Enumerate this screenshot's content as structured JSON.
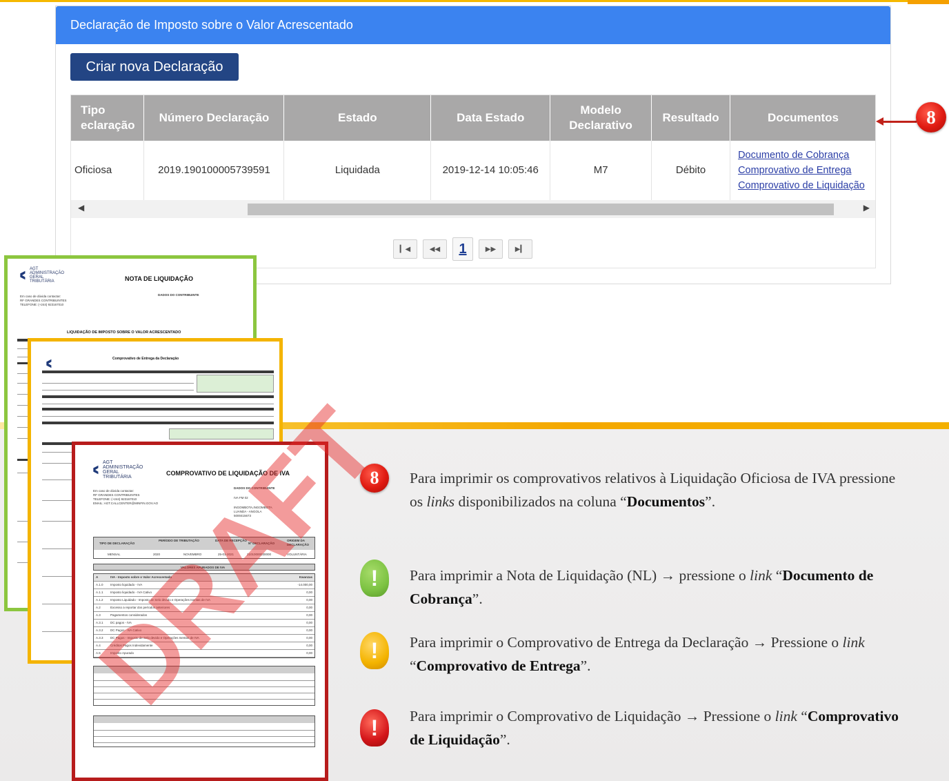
{
  "panel": {
    "title": "Declaração de Imposto sobre o Valor Acrescentado",
    "new_button": "Criar nova Declaração"
  },
  "table": {
    "columns": [
      "Tipo\nDeclaração",
      "Número Declaração",
      "Estado",
      "Data Estado",
      "Modelo\nDeclarativo",
      "Resultado",
      "Documentos"
    ],
    "col_first_visible": "Tipo",
    "col_first_visible2": "eclaração",
    "col_modelo_1": "Modelo",
    "col_modelo_2": "Declarativo",
    "row": {
      "tipo": "Oficiosa",
      "numero": "2019.190100005739591",
      "estado": "Liquidada",
      "data": "2019-12-14 10:05:46",
      "modelo": "M7",
      "resultado": "Débito",
      "docs": [
        "Documento de Cobrança",
        "Comprovativo de Entrega",
        "Comprovativo de Liquidação"
      ]
    }
  },
  "pager": {
    "first": "⏮",
    "prev": "⏪",
    "current": "1",
    "next": "⏩",
    "last": "⏭"
  },
  "callout_badge": "8",
  "docs": {
    "green_title": "NOTA DE LIQUIDAÇÃO",
    "green_subtitle": "LIQUIDAÇÃO DE IMPOSTO SOBRE O VALOR ACRESCENTADO",
    "yellow_title": "Comprovativo de Entrega da Declaração",
    "red_title": "COMPROVATIVO DE LIQUIDAÇÃO DE IVA",
    "red_section": "VALORES APURADOS DE IVA",
    "logo_lines": [
      "AGT",
      "ADMINISTRAÇÃO",
      "GERAL",
      "TRIBUTÁRIA"
    ],
    "contacts": [
      "Em caso de dúvida contactar:",
      "RF GRANDES CONTRIBUINTES",
      "TELEFONE: (+244) 923167010",
      "EMAIL: AGT.CALLCENTER@MINFIN.GOV.AO"
    ],
    "dados": "DADOS DO CONTRIBUINTE",
    "dados_lines": [
      "IVA FM 02",
      "INGOMBOTA,INGOMBOTA",
      "LUANDA - ANGOLA",
      "5000415673"
    ],
    "head_row": [
      "TIPO DE DECLARAÇÃO",
      "PERÍODO DE TRIBUTAÇÃO",
      "DATA DE RECEPÇÃO",
      "Nº DECLARAÇÃO",
      "ORIGEM DA DECLARAÇÃO"
    ],
    "data_row": [
      "MENSAL",
      "2020",
      "NOVEMBRO",
      "25-01-2021",
      "21010000030000",
      "VOLUNTÁRIA"
    ],
    "a_rows": [
      "IVA - Imposto sobre o Valor Acrescentado",
      "Imposto liquidado - IVA",
      "Imposto liquidado - IVA Cativo",
      "Imposto Liquidado - Imposto de Selo devido e Operações Isentas de IVA",
      "Excesso a reportar dos períodos anteriores",
      "Pagamentos considerados",
      "DC pagos - IVA",
      "DC Pagos - IVA Cativo",
      "DC Pagos - Imposto de Selo devido e Operações Isentas de IVA",
      "Créditos Pagos Indevidamente",
      "Imposto Apurado"
    ],
    "a_codes": [
      "A",
      "A.1.0",
      "A.1.1",
      "A.1.2",
      "A.2",
      "A.3",
      "A.3.1",
      "A.3.2",
      "A.3.3",
      "A.4",
      "A.5"
    ],
    "a_values": [
      "Kwanzas",
      "-14.000,00",
      "0,00",
      "0,00",
      "0,00",
      "0,00",
      "0,00",
      "0,00",
      "0,00",
      "0,00",
      "0,00"
    ],
    "watermark": "DRAFT"
  },
  "notes": {
    "p1_a": "Para imprimir os comprovativos relativos à Liquidação Oficiosa de IVA pressione os ",
    "p1_em": "links",
    "p1_b": " disponibilizados na coluna “",
    "p1_strong": "Documentos",
    "p1_c": "”.",
    "p2_a": "Para imprimir a Nota de Liquidação (NL) → pressione o ",
    "p2_em": "link",
    "p2_b": " “",
    "p2_strong": "Documento de Cobrança",
    "p2_c": "”.",
    "p3_a": "Para imprimir o Comprovativo de Entrega da Declaração → Pressione o ",
    "p3_em": "link",
    "p3_b": " “",
    "p3_strong": "Comprovativo de Entrega",
    "p3_c": "”.",
    "p4_a": "Para imprimir o Comprovativo de Liquidação → Pressione o ",
    "p4_em": "link",
    "p4_b": " “",
    "p4_strong": "Comprovativo de Liquidação",
    "p4_c": "”.",
    "exclaim": "!",
    "colors": {
      "green": "#7cc242",
      "yellow": "#f4b400",
      "red": "#d4161a",
      "badge": "#e01b12"
    }
  }
}
